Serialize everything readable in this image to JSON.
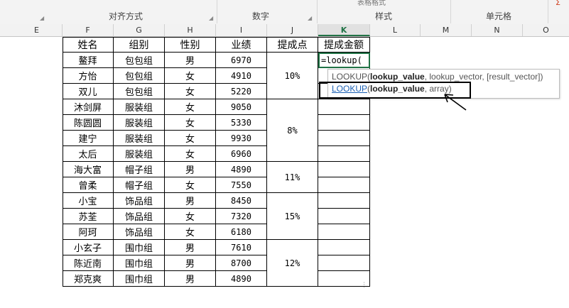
{
  "ribbon": {
    "top_partial": "表格格式",
    "groups": [
      "对齐方式",
      "数字",
      "样式",
      "单元格"
    ]
  },
  "columns": [
    "E",
    "F",
    "G",
    "H",
    "I",
    "J",
    "K",
    "L",
    "M",
    "N",
    "O"
  ],
  "active_column": "K",
  "table": {
    "headers": [
      "姓名",
      "组别",
      "性别",
      "业绩",
      "提成点",
      "提成金额"
    ],
    "rows": [
      {
        "name": "鳌拜",
        "group": "包包组",
        "gender": "男",
        "sales": "6970"
      },
      {
        "name": "方怡",
        "group": "包包组",
        "gender": "女",
        "sales": "4910"
      },
      {
        "name": "双儿",
        "group": "包包组",
        "gender": "女",
        "sales": "5220"
      },
      {
        "name": "沐剑屏",
        "group": "服装组",
        "gender": "女",
        "sales": "9050"
      },
      {
        "name": "陈圆圆",
        "group": "服装组",
        "gender": "女",
        "sales": "5330"
      },
      {
        "name": "建宁",
        "group": "服装组",
        "gender": "女",
        "sales": "9930"
      },
      {
        "name": "太后",
        "group": "服装组",
        "gender": "女",
        "sales": "6960"
      },
      {
        "name": "海大富",
        "group": "帽子组",
        "gender": "男",
        "sales": "4890"
      },
      {
        "name": "曾柔",
        "group": "帽子组",
        "gender": "女",
        "sales": "7550"
      },
      {
        "name": "小宝",
        "group": "饰品组",
        "gender": "男",
        "sales": "8450"
      },
      {
        "name": "苏荃",
        "group": "饰品组",
        "gender": "女",
        "sales": "7320"
      },
      {
        "name": "阿珂",
        "group": "饰品组",
        "gender": "女",
        "sales": "6180"
      },
      {
        "name": "小玄子",
        "group": "围巾组",
        "gender": "男",
        "sales": "7610"
      },
      {
        "name": "陈近南",
        "group": "围巾组",
        "gender": "男",
        "sales": "8700"
      },
      {
        "name": "郑克爽",
        "group": "围巾组",
        "gender": "男",
        "sales": "4890"
      }
    ],
    "rates": [
      {
        "value": "10%",
        "span": 3
      },
      {
        "value": "8%",
        "span": 4
      },
      {
        "value": "11%",
        "span": 2
      },
      {
        "value": "15%",
        "span": 3
      },
      {
        "value": "12%",
        "span": 3
      }
    ]
  },
  "active_cell": {
    "formula": "=lookup("
  },
  "tooltip": {
    "line1": {
      "fn": "LOOKUP",
      "open": "(",
      "bold_arg": "lookup_value",
      "rest": ", lookup_vector, [result_vector])"
    },
    "line2": {
      "fn": "LOOKUP",
      "open": "(",
      "bold_arg": "lookup_value",
      "rest": ", array)"
    }
  }
}
